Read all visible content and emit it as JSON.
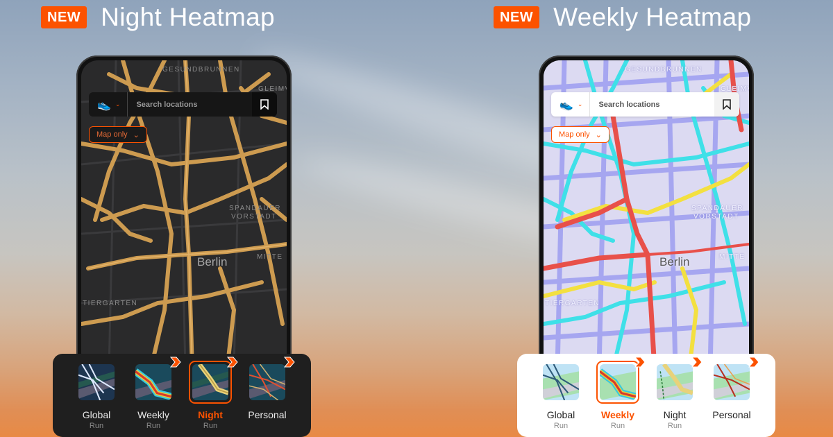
{
  "colors": {
    "accent": "#fc5200"
  },
  "panels": [
    {
      "id": "night",
      "badge": "NEW",
      "title": "Night Heatmap",
      "theme": "dark",
      "search": {
        "placeholder": "Search locations",
        "sport_icon": "shoe-icon"
      },
      "map_mode": "Map only",
      "map_labels": {
        "top": "GESUNDBRUNNEN",
        "top_right": "GLEIMVIE",
        "district": "SPANDAUER",
        "district2": "VORSTADT",
        "mitte": "MITTE",
        "city": "Berlin",
        "tiergarten": "TIERGARTEN"
      },
      "options": [
        {
          "label": "Global",
          "sub": "Run",
          "premium": false,
          "selected": false
        },
        {
          "label": "Weekly",
          "sub": "Run",
          "premium": true,
          "selected": false
        },
        {
          "label": "Night",
          "sub": "Run",
          "premium": true,
          "selected": true
        },
        {
          "label": "Personal",
          "sub": "",
          "premium": true,
          "selected": false
        }
      ]
    },
    {
      "id": "weekly",
      "badge": "NEW",
      "title": "Weekly Heatmap",
      "theme": "light",
      "search": {
        "placeholder": "Search locations",
        "sport_icon": "shoe-icon"
      },
      "map_mode": "Map only",
      "map_labels": {
        "top": "GESUNDBRUNNEN",
        "top_right": "GLEIMVIE",
        "district": "SPANDAUER",
        "district2": "VORSTADT",
        "mitte": "MITTE",
        "city": "Berlin",
        "tiergarten": "TIERGARTEN"
      },
      "options": [
        {
          "label": "Global",
          "sub": "Run",
          "premium": false,
          "selected": false
        },
        {
          "label": "Weekly",
          "sub": "Run",
          "premium": true,
          "selected": true
        },
        {
          "label": "Night",
          "sub": "Run",
          "premium": true,
          "selected": false
        },
        {
          "label": "Personal",
          "sub": "",
          "premium": true,
          "selected": false
        }
      ]
    }
  ]
}
